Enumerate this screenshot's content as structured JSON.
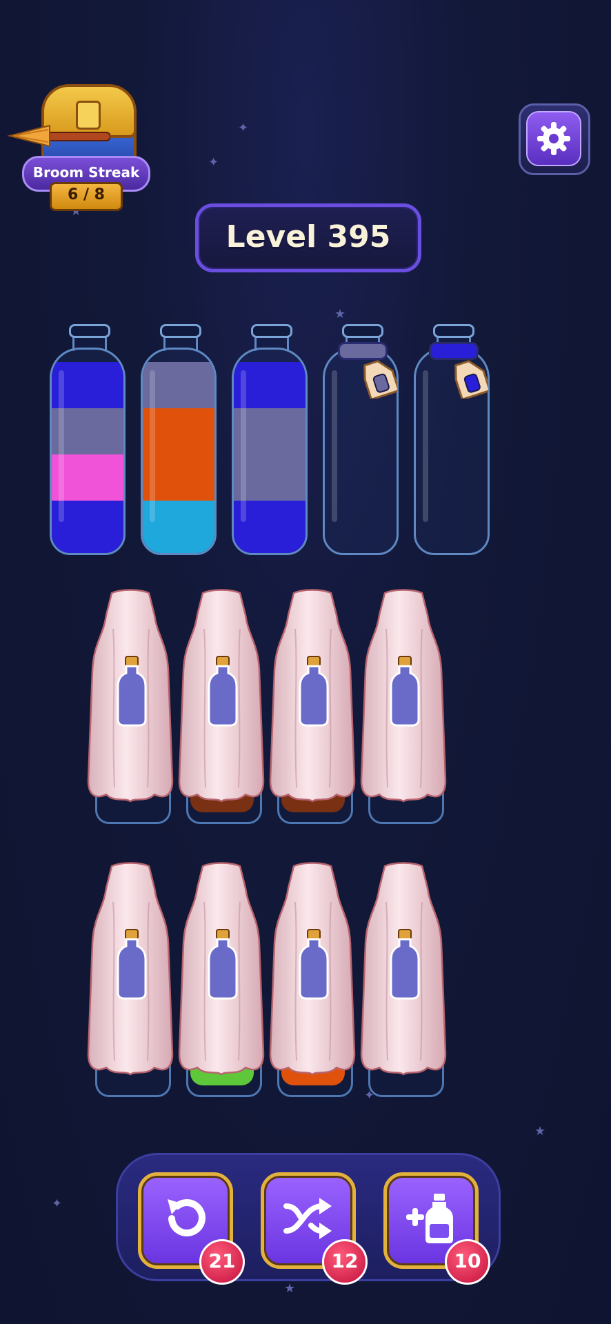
{
  "streak": {
    "title": "Broom Streak",
    "count": "6 / 8"
  },
  "level": {
    "label": "Level 395"
  },
  "colors": {
    "blue": "#2a1fd9",
    "slate": "#6b6a9e",
    "pink": "#f052d8",
    "orange": "#e0520c",
    "cyan": "#1ea8dc",
    "green": "#5fc83a",
    "brown": "#7a3012",
    "cloth": "#f1d2d8",
    "accent": "#7a4ff0"
  },
  "bottles_row1": [
    {
      "name": "bottle-1",
      "layers": [
        "blue",
        "slate",
        "pink",
        "blue"
      ],
      "locked": false
    },
    {
      "name": "bottle-2",
      "layers": [
        "slate",
        "orange",
        "orange",
        "cyan"
      ],
      "locked": false
    },
    {
      "name": "bottle-3",
      "layers": [
        "blue",
        "slate",
        "slate",
        "blue"
      ],
      "locked": false
    },
    {
      "name": "bottle-4",
      "layers": [],
      "locked": true,
      "rope": "slate"
    },
    {
      "name": "bottle-5",
      "layers": [],
      "locked": true,
      "rope": "blue"
    }
  ],
  "covered_row2": [
    {
      "name": "covered-bottle-1",
      "visible_liquid": null
    },
    {
      "name": "covered-bottle-2",
      "visible_liquid": "brown"
    },
    {
      "name": "covered-bottle-3",
      "visible_liquid": "brown"
    },
    {
      "name": "covered-bottle-4",
      "visible_liquid": null
    }
  ],
  "covered_row3": [
    {
      "name": "covered-bottle-5",
      "visible_liquid": null
    },
    {
      "name": "covered-bottle-6",
      "visible_liquid": "green"
    },
    {
      "name": "covered-bottle-7",
      "visible_liquid": "orange"
    },
    {
      "name": "covered-bottle-8",
      "visible_liquid": null
    }
  ],
  "boosters": [
    {
      "name": "undo",
      "icon": "undo-icon",
      "count": "21"
    },
    {
      "name": "shuffle",
      "icon": "shuffle-icon",
      "count": "12"
    },
    {
      "name": "add-bottle",
      "icon": "add-bottle-icon",
      "count": "10"
    }
  ]
}
